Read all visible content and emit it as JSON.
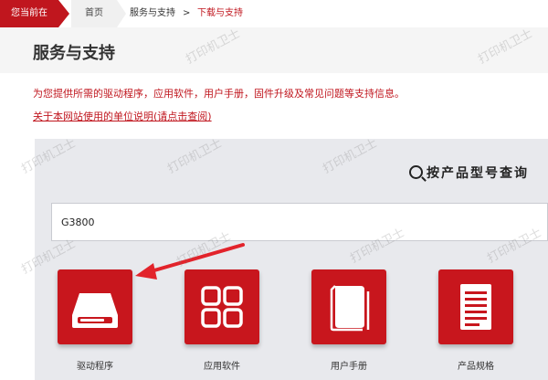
{
  "breadcrumb": {
    "here": "您当前在",
    "home": "首页",
    "service": "服务与支持",
    "sep": ">",
    "current": "下载与支持"
  },
  "header": {
    "title": "服务与支持",
    "intro": "为您提供所需的驱动程序，应用软件，用户手册，固件升级及常见问题等支持信息。",
    "note_link": "关于本网站使用的单位说明(请点击查阅)"
  },
  "search": {
    "heading": "按产品型号查询",
    "value": "G3800"
  },
  "tiles": [
    {
      "label": "驱动程序",
      "icon": "hard-drive-icon"
    },
    {
      "label": "应用软件",
      "icon": "app-grid-icon"
    },
    {
      "label": "用户手册",
      "icon": "manual-book-icon"
    },
    {
      "label": "产品规格",
      "icon": "spec-document-icon"
    }
  ],
  "watermark": "打印机卫士",
  "colors": {
    "brand_red": "#c0161e",
    "panel_bg": "#e8e9ed",
    "tile_red": "#c8161d"
  }
}
